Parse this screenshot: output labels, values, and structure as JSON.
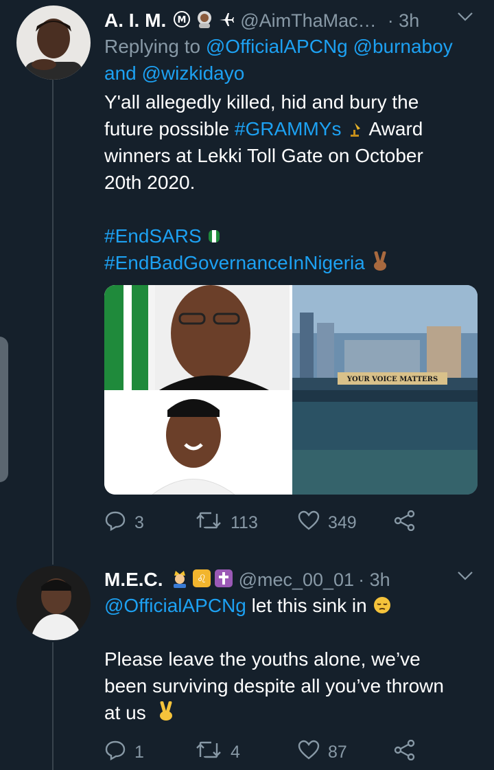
{
  "tweet1": {
    "name": "A. I. M.",
    "handle": "@AimThaMac…",
    "time": "· 3h",
    "reply_prefix": "Replying to ",
    "reply_to_1": "@OfficialAPCNg",
    "reply_to_2": "@burnaboy",
    "reply_and": "and ",
    "reply_to_3": "@wizkidayo",
    "text_line_1": "Y'all allegedly killed, hid and bury the",
    "text_line_2_a": "future possible ",
    "hashtag_grammys": "#GRAMMYs",
    "text_line_2_b": " Award",
    "text_line_3": "winners at Lekki Toll Gate on October",
    "text_line_4": "20th 2020.",
    "hashtag_endsars": "#EndSARS",
    "hashtag_badgov": "#EndBadGovernanceInNigeria",
    "media_banner_text": "YOUR VOICE MATTERS",
    "replies": "3",
    "retweets": "113",
    "likes": "349"
  },
  "tweet2": {
    "name": "M.E.C.",
    "handle": "@mec_00_01",
    "time": "· 3h",
    "mention": "@OfficialAPCNg",
    "text_a": " let this sink in",
    "text_line_2": "Please leave the youths alone, we’ve",
    "text_line_3": "been surviving despite all you’ve thrown",
    "text_line_4": "at us",
    "replies": "1",
    "retweets": "4",
    "likes": "87"
  },
  "colors": {
    "background": "#15202b",
    "link": "#1da1f2",
    "muted": "#8899a6",
    "divider": "#38444d"
  }
}
